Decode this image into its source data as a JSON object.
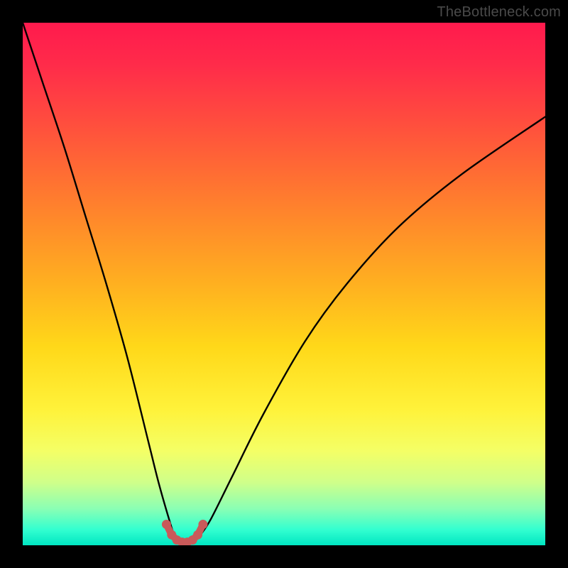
{
  "watermark": "TheBottleneck.com",
  "chart_data": {
    "type": "line",
    "title": "",
    "xlabel": "",
    "ylabel": "",
    "xlim": [
      0,
      100
    ],
    "ylim": [
      0,
      100
    ],
    "grid": false,
    "legend": false,
    "series": [
      {
        "name": "bottleneck-curve",
        "x": [
          0,
          4,
          8,
          12,
          16,
          20,
          24,
          26,
          28,
          29,
          30,
          31,
          32,
          33,
          34,
          36,
          40,
          46,
          54,
          62,
          72,
          84,
          100
        ],
        "y": [
          100,
          88,
          76,
          63,
          50,
          36,
          20,
          12,
          5,
          2,
          1,
          0.5,
          0.5,
          1,
          2,
          5,
          13,
          25,
          39,
          50,
          61,
          71,
          82
        ]
      }
    ],
    "markers": {
      "name": "valley-highlight",
      "x": [
        27.5,
        28.5,
        29.5,
        30.5,
        31.5,
        32.5,
        33.5,
        34.5
      ],
      "y": [
        4.0,
        2.0,
        1.0,
        0.6,
        0.6,
        1.0,
        2.0,
        4.0
      ]
    },
    "gradient_colors": {
      "top": "#ff1a4d",
      "mid": "#ffd819",
      "bottom": "#00e6c2"
    }
  }
}
